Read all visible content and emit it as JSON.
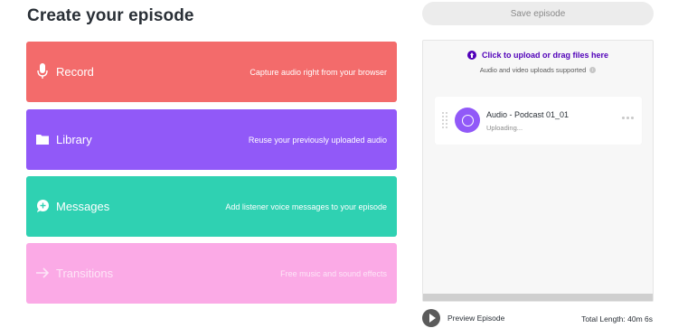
{
  "page_title": "Create your episode",
  "cards": {
    "record": {
      "label": "Record",
      "description": "Capture audio right from your browser",
      "icon": "microphone-icon",
      "color": "#f36b6b"
    },
    "library": {
      "label": "Library",
      "description": "Reuse your previously uploaded audio",
      "icon": "folder-icon",
      "color": "#9159f8"
    },
    "messages": {
      "label": "Messages",
      "description": "Add listener voice messages to your episode",
      "icon": "message-plus-icon",
      "color": "#2fd1b2"
    },
    "transitions": {
      "label": "Transitions",
      "description": "Free music and sound effects",
      "icon": "arrow-right-icon",
      "color": "#fbaae6"
    }
  },
  "toolbar": {
    "save_label": "Save episode"
  },
  "upload": {
    "cta": "Click to upload or drag files here",
    "supported": "Audio and video uploads supported",
    "info_icon": "i"
  },
  "episode_item": {
    "title": "Audio - Podcast 01_01",
    "status": "Uploading...",
    "accent": "#9159f8"
  },
  "footer": {
    "preview_label": "Preview Episode",
    "total_length": "Total Length: 40m 6s"
  },
  "accent_color": "#5000b9"
}
